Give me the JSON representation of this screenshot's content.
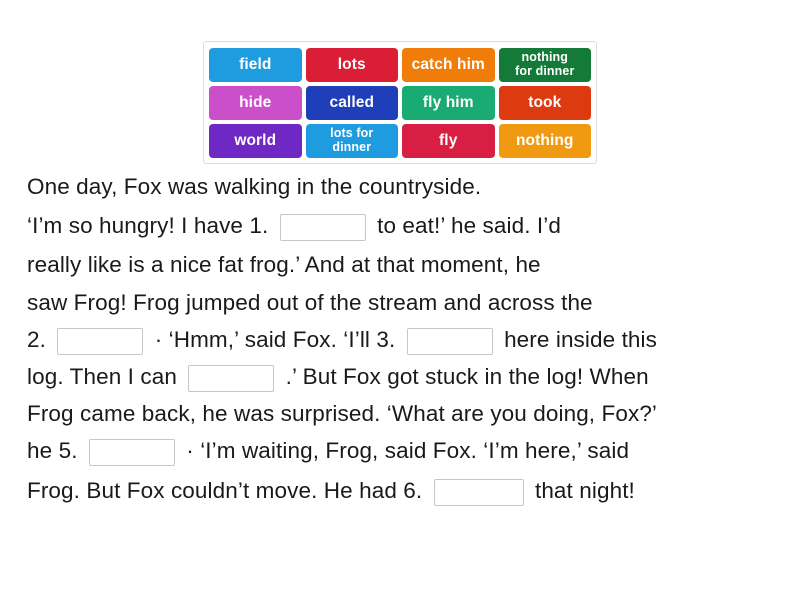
{
  "word_bank": {
    "rows": [
      [
        {
          "label": "field",
          "color": "#1f9ce0",
          "lines": 1
        },
        {
          "label": "lots",
          "color": "#d91e35",
          "lines": 1
        },
        {
          "label": "catch him",
          "color": "#f07d0a",
          "lines": 1
        },
        {
          "label": "nothing\nfor dinner",
          "color": "#137a38",
          "lines": 2
        }
      ],
      [
        {
          "label": "hide",
          "color": "#cb4fc8",
          "lines": 1
        },
        {
          "label": "called",
          "color": "#1f3fb8",
          "lines": 1
        },
        {
          "label": "fly him",
          "color": "#1aab73",
          "lines": 1
        },
        {
          "label": "took",
          "color": "#dd3a12",
          "lines": 1
        }
      ],
      [
        {
          "label": "world",
          "color": "#6f28c4",
          "lines": 1
        },
        {
          "label": "lots for\ndinner",
          "color": "#1f9ce0",
          "lines": 2
        },
        {
          "label": "fly",
          "color": "#d91e44",
          "lines": 1
        },
        {
          "label": "nothing",
          "color": "#f09a12",
          "lines": 1
        }
      ]
    ]
  },
  "story": {
    "line1": "One day, Fox was walking in the countryside.",
    "line2_before": "‘I’m so hungry! I have 1.",
    "line2_after": "to eat!’ he said. I’d",
    "line3": "really like is a nice fat frog.’ And at that moment, he",
    "line4": "saw Frog! Frog jumped out of the stream and across the",
    "line5_before": "2.",
    "line5_mid": "· ‘Hmm,’ said Fox. ‘I’ll 3.",
    "line5_after": "here inside this",
    "line6_before": "log. Then I can",
    "line6_after": ".’ But Fox got stuck in the log! When",
    "line7": "Frog came back, he was surprised. ‘What are you doing, Fox?’",
    "line8_before": "he 5.",
    "line8_after": "· ‘I’m waiting, Frog, said Fox. ‘I’m here,’ said",
    "line9_before": "Frog. But Fox couldn’t move. He had 6.",
    "line9_after": "that night!"
  },
  "blanks": {
    "b1": "",
    "b2": "",
    "b3": "",
    "b4": "",
    "b5": "",
    "b6": ""
  }
}
